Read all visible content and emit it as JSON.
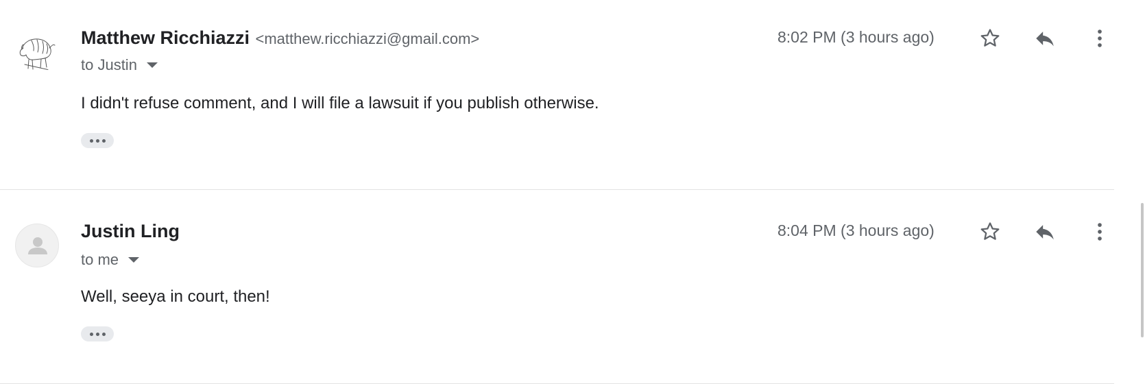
{
  "messages": [
    {
      "sender_name": "Matthew Ricchiazzi",
      "sender_email": "<matthew.ricchiazzi@gmail.com>",
      "recipient": "to Justin",
      "timestamp": "8:02 PM (3 hours ago)",
      "body": "I didn't refuse comment, and I will file a lawsuit if you publish otherwise.",
      "avatar_icon": "bison-sketch-avatar"
    },
    {
      "sender_name": "Justin Ling",
      "sender_email": "",
      "recipient": "to me",
      "timestamp": "8:04 PM (3 hours ago)",
      "body": "Well, seeya in court, then!",
      "avatar_icon": "default-person-avatar"
    }
  ],
  "icons": {
    "star": "star-outline-icon",
    "reply": "reply-icon",
    "more": "more-vert-icon",
    "expand": "show-trimmed-content-icon",
    "caret": "caret-down-icon"
  },
  "colors": {
    "primary_text": "#202124",
    "secondary_text": "#5f6368",
    "icon": "#5f6368",
    "divider": "#e3e3e3",
    "chip_bg": "#e8eaed"
  }
}
